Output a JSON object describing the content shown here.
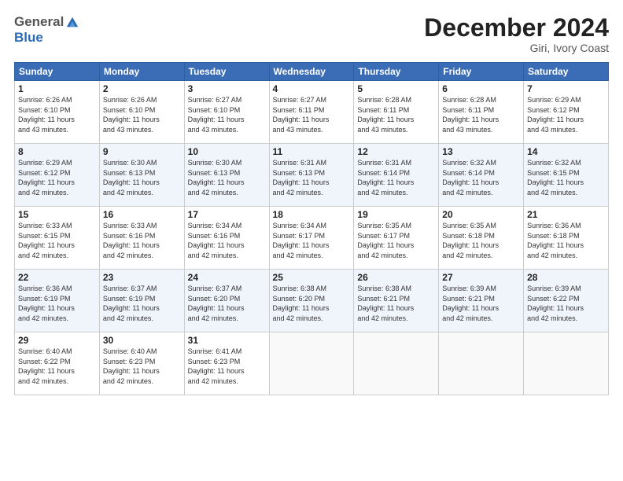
{
  "logo": {
    "general": "General",
    "blue": "Blue"
  },
  "header": {
    "month": "December 2024",
    "location": "Giri, Ivory Coast"
  },
  "days_of_week": [
    "Sunday",
    "Monday",
    "Tuesday",
    "Wednesday",
    "Thursday",
    "Friday",
    "Saturday"
  ],
  "weeks": [
    [
      {
        "day": "1",
        "info": "Sunrise: 6:26 AM\nSunset: 6:10 PM\nDaylight: 11 hours\nand 43 minutes."
      },
      {
        "day": "2",
        "info": "Sunrise: 6:26 AM\nSunset: 6:10 PM\nDaylight: 11 hours\nand 43 minutes."
      },
      {
        "day": "3",
        "info": "Sunrise: 6:27 AM\nSunset: 6:10 PM\nDaylight: 11 hours\nand 43 minutes."
      },
      {
        "day": "4",
        "info": "Sunrise: 6:27 AM\nSunset: 6:11 PM\nDaylight: 11 hours\nand 43 minutes."
      },
      {
        "day": "5",
        "info": "Sunrise: 6:28 AM\nSunset: 6:11 PM\nDaylight: 11 hours\nand 43 minutes."
      },
      {
        "day": "6",
        "info": "Sunrise: 6:28 AM\nSunset: 6:11 PM\nDaylight: 11 hours\nand 43 minutes."
      },
      {
        "day": "7",
        "info": "Sunrise: 6:29 AM\nSunset: 6:12 PM\nDaylight: 11 hours\nand 43 minutes."
      }
    ],
    [
      {
        "day": "8",
        "info": "Sunrise: 6:29 AM\nSunset: 6:12 PM\nDaylight: 11 hours\nand 42 minutes."
      },
      {
        "day": "9",
        "info": "Sunrise: 6:30 AM\nSunset: 6:13 PM\nDaylight: 11 hours\nand 42 minutes."
      },
      {
        "day": "10",
        "info": "Sunrise: 6:30 AM\nSunset: 6:13 PM\nDaylight: 11 hours\nand 42 minutes."
      },
      {
        "day": "11",
        "info": "Sunrise: 6:31 AM\nSunset: 6:13 PM\nDaylight: 11 hours\nand 42 minutes."
      },
      {
        "day": "12",
        "info": "Sunrise: 6:31 AM\nSunset: 6:14 PM\nDaylight: 11 hours\nand 42 minutes."
      },
      {
        "day": "13",
        "info": "Sunrise: 6:32 AM\nSunset: 6:14 PM\nDaylight: 11 hours\nand 42 minutes."
      },
      {
        "day": "14",
        "info": "Sunrise: 6:32 AM\nSunset: 6:15 PM\nDaylight: 11 hours\nand 42 minutes."
      }
    ],
    [
      {
        "day": "15",
        "info": "Sunrise: 6:33 AM\nSunset: 6:15 PM\nDaylight: 11 hours\nand 42 minutes."
      },
      {
        "day": "16",
        "info": "Sunrise: 6:33 AM\nSunset: 6:16 PM\nDaylight: 11 hours\nand 42 minutes."
      },
      {
        "day": "17",
        "info": "Sunrise: 6:34 AM\nSunset: 6:16 PM\nDaylight: 11 hours\nand 42 minutes."
      },
      {
        "day": "18",
        "info": "Sunrise: 6:34 AM\nSunset: 6:17 PM\nDaylight: 11 hours\nand 42 minutes."
      },
      {
        "day": "19",
        "info": "Sunrise: 6:35 AM\nSunset: 6:17 PM\nDaylight: 11 hours\nand 42 minutes."
      },
      {
        "day": "20",
        "info": "Sunrise: 6:35 AM\nSunset: 6:18 PM\nDaylight: 11 hours\nand 42 minutes."
      },
      {
        "day": "21",
        "info": "Sunrise: 6:36 AM\nSunset: 6:18 PM\nDaylight: 11 hours\nand 42 minutes."
      }
    ],
    [
      {
        "day": "22",
        "info": "Sunrise: 6:36 AM\nSunset: 6:19 PM\nDaylight: 11 hours\nand 42 minutes."
      },
      {
        "day": "23",
        "info": "Sunrise: 6:37 AM\nSunset: 6:19 PM\nDaylight: 11 hours\nand 42 minutes."
      },
      {
        "day": "24",
        "info": "Sunrise: 6:37 AM\nSunset: 6:20 PM\nDaylight: 11 hours\nand 42 minutes."
      },
      {
        "day": "25",
        "info": "Sunrise: 6:38 AM\nSunset: 6:20 PM\nDaylight: 11 hours\nand 42 minutes."
      },
      {
        "day": "26",
        "info": "Sunrise: 6:38 AM\nSunset: 6:21 PM\nDaylight: 11 hours\nand 42 minutes."
      },
      {
        "day": "27",
        "info": "Sunrise: 6:39 AM\nSunset: 6:21 PM\nDaylight: 11 hours\nand 42 minutes."
      },
      {
        "day": "28",
        "info": "Sunrise: 6:39 AM\nSunset: 6:22 PM\nDaylight: 11 hours\nand 42 minutes."
      }
    ],
    [
      {
        "day": "29",
        "info": "Sunrise: 6:40 AM\nSunset: 6:22 PM\nDaylight: 11 hours\nand 42 minutes."
      },
      {
        "day": "30",
        "info": "Sunrise: 6:40 AM\nSunset: 6:23 PM\nDaylight: 11 hours\nand 42 minutes."
      },
      {
        "day": "31",
        "info": "Sunrise: 6:41 AM\nSunset: 6:23 PM\nDaylight: 11 hours\nand 42 minutes."
      },
      {
        "day": "",
        "info": ""
      },
      {
        "day": "",
        "info": ""
      },
      {
        "day": "",
        "info": ""
      },
      {
        "day": "",
        "info": ""
      }
    ]
  ]
}
